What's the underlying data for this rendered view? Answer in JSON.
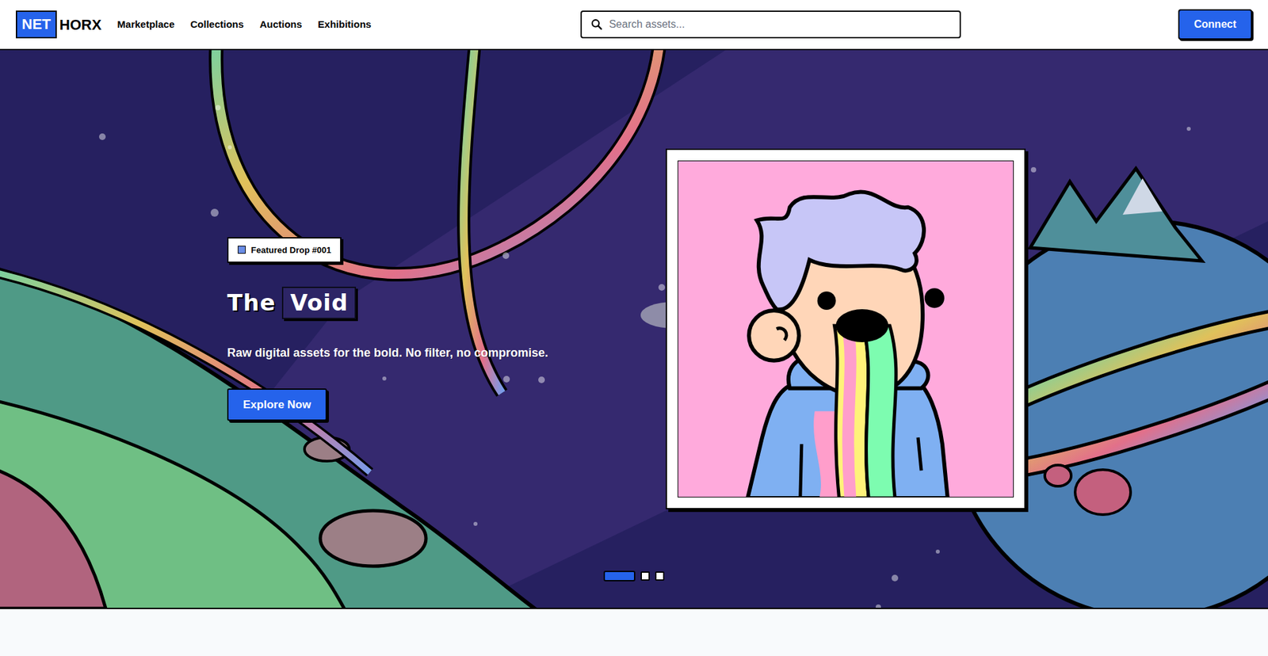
{
  "logo": {
    "part1": "NET",
    "part2": "HORX"
  },
  "nav": {
    "items": [
      "Marketplace",
      "Collections",
      "Auctions",
      "Exhibitions"
    ]
  },
  "search": {
    "placeholder": "Search assets..."
  },
  "connect_button": "Connect",
  "hero": {
    "badge": "Featured Drop #001",
    "title": "The",
    "title_highlight": "Void",
    "subtitle": "Raw digital assets for the bold. No filter, no compromise.",
    "cta": "Explore Now"
  },
  "carousel": {
    "slides": [
      {
        "selected": true
      },
      {
        "selected": false
      },
      {
        "selected": false
      }
    ]
  }
}
